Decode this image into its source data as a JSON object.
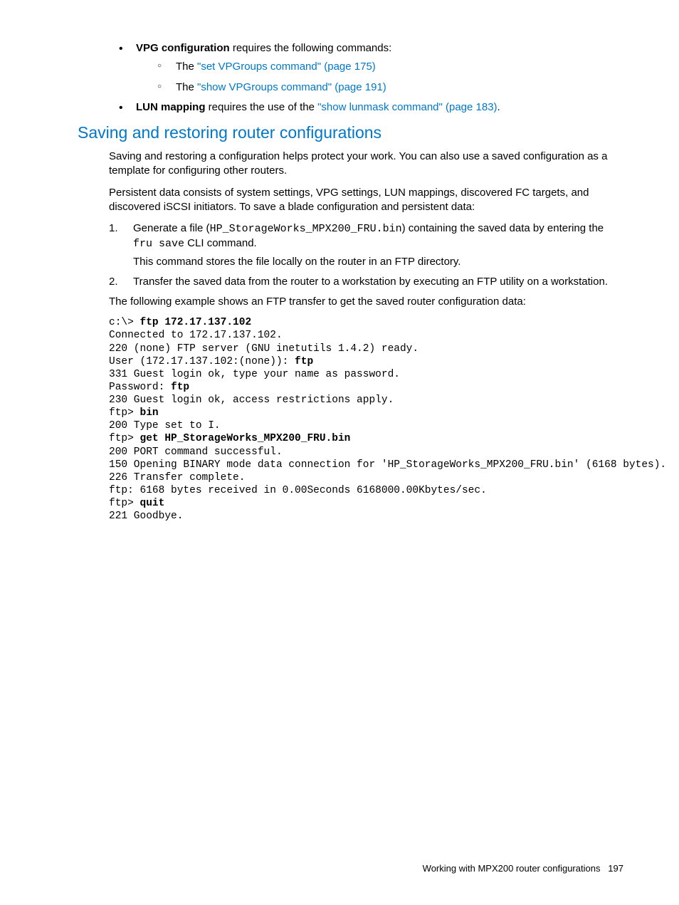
{
  "bullets": {
    "vpg_label": "VPG configuration",
    "vpg_text": " requires the following commands:",
    "sub1_prefix": "The ",
    "sub1_link": "\"set VPGroups command\" (page 175)",
    "sub2_prefix": "The ",
    "sub2_link": "\"show VPGroups command\" (page 191)",
    "lun_label": "LUN mapping",
    "lun_text": " requires the use of the ",
    "lun_link": "\"show lunmask command\" (page 183)",
    "lun_tail": "."
  },
  "heading": "Saving and restoring router configurations",
  "p1": "Saving and restoring a configuration helps protect your work. You can also use a saved configuration as a template for configuring other routers.",
  "p2": "Persistent data consists of system settings, VPG settings, LUN mappings, discovered FC targets, and discovered iSCSI initiators. To save a blade configuration and persistent data:",
  "ol": {
    "m1": "1.",
    "i1a": "Generate a file (",
    "i1code1": "HP_StorageWorks_MPX200_FRU.bin",
    "i1b": ") containing the saved data by entering the ",
    "i1code2": "fru save",
    "i1c": " CLI command.",
    "i1d": "This command stores the file locally on the router in an FTP directory.",
    "m2": "2.",
    "i2": "Transfer the saved data from the router to a workstation by executing an FTP utility on a workstation."
  },
  "p3": "The following example shows an FTP transfer to get the saved router configuration data:",
  "code": {
    "l01a": "c:\\> ",
    "l01b": "ftp 172.17.137.102",
    "l02": "Connected to 172.17.137.102.",
    "l03": "220 (none) FTP server (GNU inetutils 1.4.2) ready.",
    "l04a": "User (172.17.137.102:(none)): ",
    "l04b": "ftp",
    "l05": "331 Guest login ok, type your name as password.",
    "l06a": "Password: ",
    "l06b": "ftp",
    "l07": "230 Guest login ok, access restrictions apply.",
    "l08a": "ftp> ",
    "l08b": "bin",
    "l09": "200 Type set to I.",
    "l10a": "ftp> ",
    "l10b": "get HP_StorageWorks_MPX200_FRU.bin",
    "l11": "200 PORT command successful.",
    "l12": "150 Opening BINARY mode data connection for 'HP_StorageWorks_MPX200_FRU.bin' (6168 bytes).",
    "l13": "226 Transfer complete.",
    "l14": "ftp: 6168 bytes received in 0.00Seconds 6168000.00Kbytes/sec.",
    "l15a": "ftp> ",
    "l15b": "quit",
    "l16": "221 Goodbye."
  },
  "footer": {
    "text": "Working with MPX200 router configurations",
    "page": "197"
  }
}
